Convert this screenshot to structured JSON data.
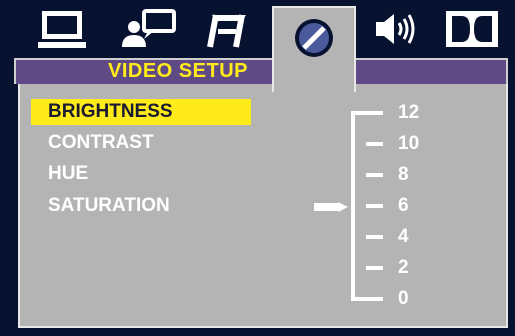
{
  "colors": {
    "background": "#071130",
    "panel": "#b4b4b4",
    "title_strip": "#5f4a86",
    "highlight": "#ffeb1a",
    "text": "#ffffff"
  },
  "tabs": [
    {
      "icon": "monitor-icon"
    },
    {
      "icon": "person-speech-icon"
    },
    {
      "icon": "music-note-icon"
    },
    {
      "icon": "video-disc-icon",
      "active": true
    },
    {
      "icon": "speaker-icon"
    },
    {
      "icon": "dolby-icon"
    }
  ],
  "title": "VIDEO  SETUP",
  "menu": {
    "items": [
      "BRIGHTNESS",
      "CONTRAST",
      "HUE",
      "SATURATION"
    ],
    "selected": "BRIGHTNESS"
  },
  "scale": {
    "labels": [
      "12",
      "10",
      "8",
      "6",
      "4",
      "2",
      "0"
    ],
    "current_value": 6
  }
}
